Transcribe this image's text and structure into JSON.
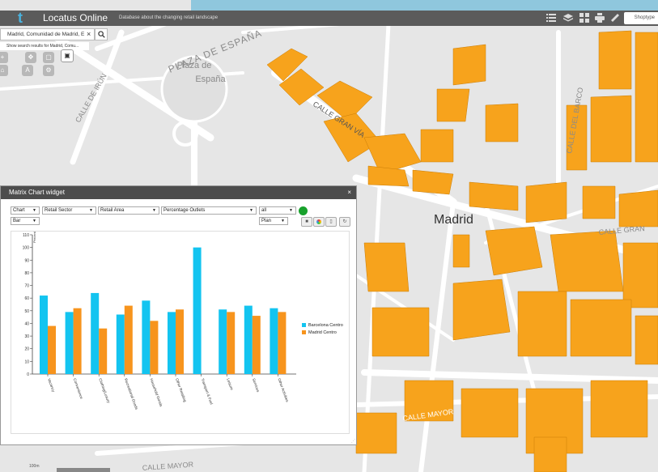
{
  "header": {
    "logo": "t",
    "app_name": "Locatus Online",
    "tagline": "Database about the changing retail landscape",
    "shoptype_label": "Shoptype"
  },
  "search": {
    "value": "Madrid, Comunidad de Madrid, E",
    "clear_icon": "close-icon",
    "button_icon": "search-icon",
    "hint": "Show search results for Madrid, Comu..."
  },
  "map": {
    "labels": {
      "plaza_espana_street": "PLAZA DE ESPAÑA",
      "plaza_line1": "Plaza de",
      "plaza_line2": "España",
      "calle_irun": "CALLE DE IRÚN",
      "gran_via": "CALLE GRAN VÍA",
      "calle_barco": "CALLE DEL BARCO",
      "madrid": "Madrid",
      "calle_gran_right": "CALLE GRAN",
      "calle_mayor": "CALLE MAYOR",
      "calle_mayor_bottom": "CALLE MAYOR"
    },
    "scale": "100m",
    "colors": {
      "building": "#f7a31c",
      "road": "#ffffff",
      "base": "#e6e6e6"
    }
  },
  "widget": {
    "title": "Matrix Chart widget",
    "close": "×",
    "controls": {
      "view": "Chart",
      "dimension1": "Retail Sector",
      "dimension2": "Retail Area",
      "measure": "Percentage Outlets",
      "filter": "all",
      "chart_kind": "Bar",
      "mode": "Plan"
    }
  },
  "chart_data": {
    "type": "bar",
    "ylabel": "Percentage",
    "ylim": [
      0,
      110
    ],
    "yticks": [
      0,
      10,
      20,
      30,
      40,
      50,
      60,
      70,
      80,
      90,
      100,
      110
    ],
    "categories": [
      "Vacancy",
      "Convenience",
      "Clothing/Luxury",
      "Recreational Goods",
      "Household Goods",
      "Other Retailing",
      "Transport & Fuel",
      "Leisure",
      "Services",
      "Other Activities"
    ],
    "series": [
      {
        "name": "Barcelona Centro",
        "color": "#13c4f0",
        "values": [
          62,
          49,
          64,
          47,
          58,
          49,
          100,
          51,
          54,
          52
        ]
      },
      {
        "name": "Madrid Centro",
        "color": "#f7941d",
        "values": [
          38,
          52,
          36,
          54,
          42,
          51,
          null,
          49,
          46,
          49
        ]
      }
    ],
    "legend_position": "right",
    "grid": false
  }
}
